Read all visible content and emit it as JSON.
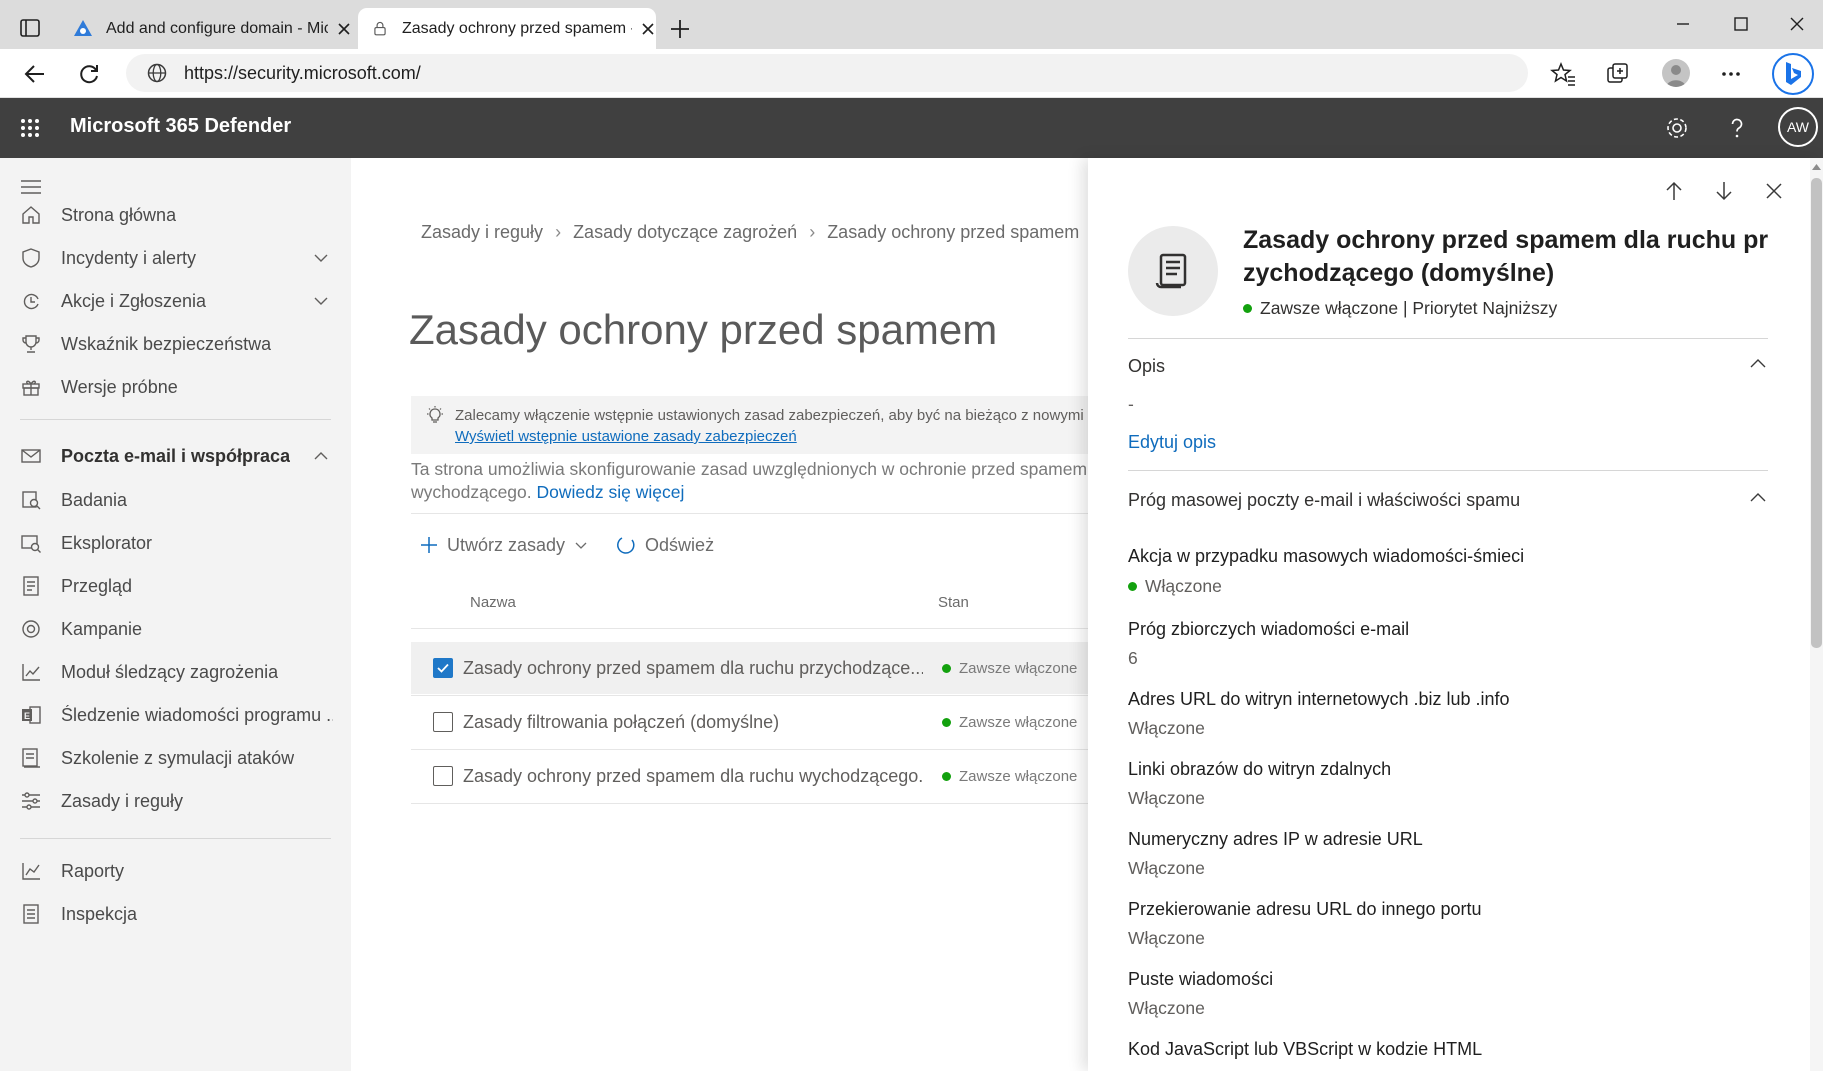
{
  "browser": {
    "tabs": [
      {
        "title": "Add and configure domain - Mic",
        "active": false
      },
      {
        "title": "Zasady ochrony przed spamem -",
        "active": true
      }
    ],
    "url": "https://security.microsoft.com/",
    "profile_initials": ""
  },
  "app": {
    "name": "Microsoft 365 Defender",
    "avatar": "AW"
  },
  "sidebar": {
    "items": [
      {
        "label": "Strona główna",
        "icon": "home-icon"
      },
      {
        "label": "Incydenty i alerty",
        "icon": "shield-icon",
        "expandable": true
      },
      {
        "label": "Akcje i Zgłoszenia",
        "icon": "actions-icon",
        "expandable": true
      },
      {
        "label": "Wskaźnik bezpieczeństwa",
        "icon": "trophy-icon"
      },
      {
        "label": "Wersje próbne",
        "icon": "gift-icon"
      },
      {
        "label": "Poczta e-mail i współpraca",
        "icon": "mail-icon",
        "expanded": true
      },
      {
        "label": "Badania",
        "icon": "investigation-icon"
      },
      {
        "label": "Eksplorator",
        "icon": "explorer-icon"
      },
      {
        "label": "Przegląd",
        "icon": "review-icon"
      },
      {
        "label": "Kampanie",
        "icon": "target-icon"
      },
      {
        "label": "Moduł śledzący zagrożenia",
        "icon": "chart-icon"
      },
      {
        "label": "Śledzenie wiadomości programu ...",
        "icon": "exchange-icon"
      },
      {
        "label": "Szkolenie z symulacji ataków",
        "icon": "training-icon"
      },
      {
        "label": "Zasady i reguły",
        "icon": "sliders-icon"
      },
      {
        "label": "Raporty",
        "icon": "reports-icon"
      },
      {
        "label": "Inspekcja",
        "icon": "audit-icon"
      }
    ]
  },
  "main": {
    "breadcrumb": [
      "Zasady i reguły",
      "Zasady dotyczące zagrożeń",
      "Zasady ochrony przed spamem"
    ],
    "title": "Zasady ochrony przed spamem",
    "banner": {
      "text": "Zalecamy włączenie wstępnie ustawionych zasad zabezpieczeń, aby być na bieżąco z nowymi ko",
      "link": "Wyświetl wstępnie ustawione zasady zabezpieczeń"
    },
    "description_line1": "Ta strona umożliwia skonfigurowanie zasad uwzględnionych w ochronie przed spamem.",
    "description_line2": "wychodzącego.",
    "learn_more": "Dowiedz się więcej",
    "toolbar": {
      "create": "Utwórz zasady",
      "refresh": "Odśwież"
    },
    "columns": {
      "name": "Nazwa",
      "status": "Stan"
    },
    "rows": [
      {
        "name": "Zasady ochrony przed spamem dla ruchu przychodzące...",
        "status": "Zawsze włączone",
        "selected": true
      },
      {
        "name": "Zasady filtrowania połączeń (domyślne)",
        "status": "Zawsze włączone",
        "selected": false
      },
      {
        "name": "Zasady ochrony przed spamem dla ruchu wychodzącego...",
        "status": "Zawsze włączone",
        "selected": false
      }
    ]
  },
  "panel": {
    "title": "Zasady ochrony przed spamem dla ruchu pr zychodzącego (domyślne)",
    "status": "Zawsze włączone | Priorytet Najniższy",
    "section1": {
      "header": "Opis",
      "value": "-",
      "edit_link": "Edytuj opis"
    },
    "section2": {
      "header": "Próg masowej poczty e-mail i właściwości spamu",
      "fields": [
        {
          "label": "Akcja w przypadku masowych wiadomości-śmieci",
          "value": "Włączone",
          "dot": true
        },
        {
          "label": "Próg zbiorczych wiadomości e-mail",
          "value": "6"
        },
        {
          "label": "Adres URL do witryn internetowych .biz lub .info",
          "value": "Włączone"
        },
        {
          "label": "Linki obrazów do witryn zdalnych",
          "value": "Włączone"
        },
        {
          "label": "Numeryczny adres IP w adresie URL",
          "value": "Włączone"
        },
        {
          "label": "Przekierowanie adresu URL do innego portu",
          "value": "Włączone"
        },
        {
          "label": "Puste wiadomości",
          "value": "Włączone"
        },
        {
          "label": "Kod JavaScript lub VBScript w kodzie HTML",
          "value": ""
        }
      ]
    }
  },
  "colors": {
    "accent": "#0f6cbd",
    "status_green": "#13a10e",
    "header_bg": "#404040"
  }
}
